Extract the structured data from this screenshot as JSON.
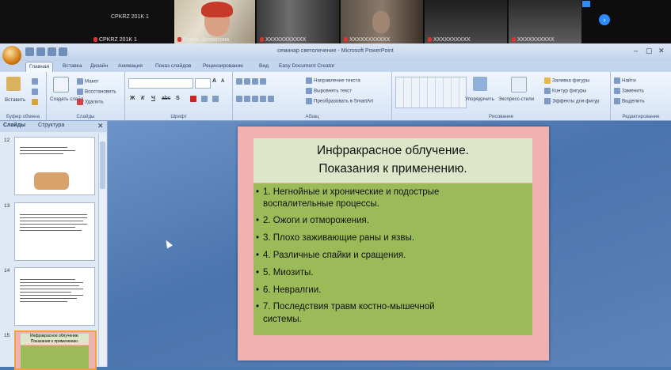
{
  "video": {
    "tiles": [
      {
        "label": "CPKRZ 201K 1",
        "name": "CPKRZ 201K 1"
      },
      {
        "label": "",
        "name": "Елена Долматова"
      },
      {
        "label": "",
        "name": "XXXXXXXXXXX"
      },
      {
        "label": "",
        "name": "XXXXXXXXXXX"
      },
      {
        "label": "",
        "name": "XXXXXXXXXX"
      },
      {
        "label": "",
        "name": "XXXXXXXXXX"
      }
    ],
    "next_arrow": "›"
  },
  "window": {
    "title": "семинар светолечение - Microsoft PowerPoint",
    "minimize": "–",
    "maximize": "▢",
    "close": "✕"
  },
  "ribbon": {
    "tabs": [
      "Главная",
      "Вставка",
      "Дизайн",
      "Анимация",
      "Показ слайдов",
      "Рецензирование",
      "Вид",
      "Easy Document Creator"
    ],
    "groups": {
      "clipboard": {
        "title": "Буфер обмена",
        "paste": "Вставить"
      },
      "slides": {
        "title": "Слайды",
        "new_slide": "Создать слайд",
        "layout": "Макет",
        "reset": "Восстановить",
        "delete": "Удалить"
      },
      "font": {
        "title": "Шрифт",
        "bold": "Ж",
        "italic": "К",
        "underline": "Ч",
        "strike": "abc",
        "shadow": "S",
        "size_up": "A",
        "size_down": "A"
      },
      "paragraph": {
        "title": "Абзац",
        "text_direction": "Направление текста",
        "align_text": "Выровнять текст",
        "smartart": "Преобразовать в SmartArt"
      },
      "drawing": {
        "title": "Рисование",
        "arrange": "Упорядочить",
        "quick_styles": "Экспресс-стили",
        "fill": "Заливка фигуры",
        "outline": "Контур фигуры",
        "effects": "Эффекты для фигур"
      },
      "editing": {
        "title": "Редактирование",
        "find": "Найти",
        "replace": "Заменить",
        "select": "Выделить"
      }
    }
  },
  "left_pane": {
    "tab_slides": "Слайды",
    "tab_outline": "Структура",
    "close": "✕",
    "thumbnails": [
      {
        "num": "12"
      },
      {
        "num": "13"
      },
      {
        "num": "14"
      },
      {
        "num": "15",
        "title": "Инфракрасное облучение. Показания к применению."
      }
    ]
  },
  "slide": {
    "title_line1": "Инфракрасное облучение.",
    "title_line2": "Показания к применению.",
    "bullets": [
      "1. Негнойные и хронические и подострые",
      "воспалительные процессы.",
      "2. Ожоги и отморожения.",
      "3. Плохо заживающие раны и язвы.",
      "4. Различные спайки и сращения.",
      "5. Миозиты.",
      "6. Невралгии.",
      "7. Последствия травм костно-мышечной",
      "системы."
    ]
  }
}
